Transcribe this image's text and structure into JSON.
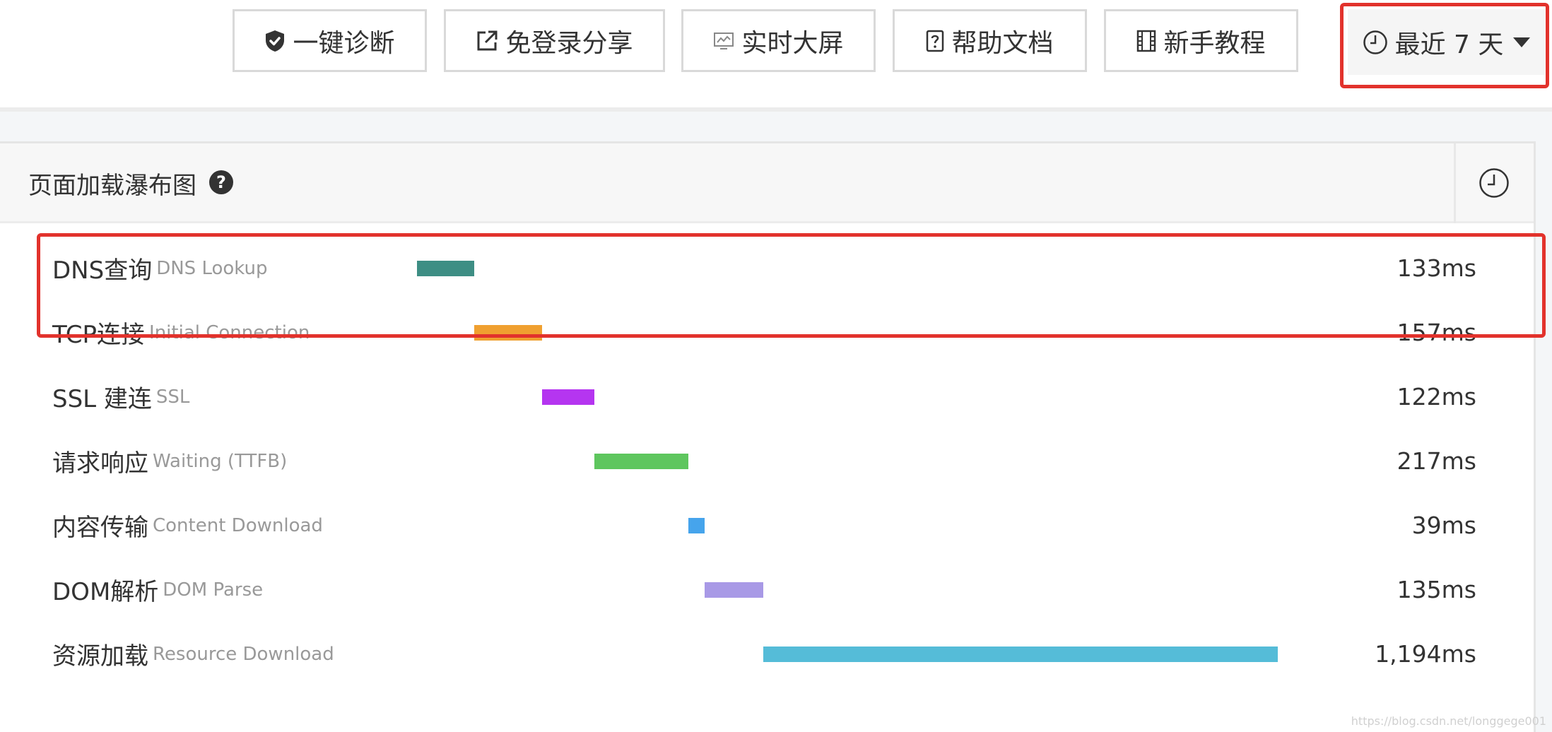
{
  "toolbar": {
    "buttons": [
      {
        "label": "一键诊断",
        "icon": "shield-icon"
      },
      {
        "label": "免登录分享",
        "icon": "share-external-icon"
      },
      {
        "label": "实时大屏",
        "icon": "monitor-icon"
      },
      {
        "label": "帮助文档",
        "icon": "help-doc-icon"
      },
      {
        "label": "新手教程",
        "icon": "film-icon"
      }
    ],
    "time_range": {
      "label": "最近 7 天",
      "icon": "clock-icon"
    }
  },
  "panel": {
    "title": "页面加载瀑布图",
    "help_icon": "?",
    "history_icon": "clock-icon"
  },
  "waterfall": {
    "rows": [
      {
        "label_zh": "DNS查询",
        "label_en": "DNS Lookup",
        "value": "133ms",
        "ms": 133,
        "color": "#3e8e84"
      },
      {
        "label_zh": "TCP连接",
        "label_en": "Initial Connection",
        "value": "157ms",
        "ms": 157,
        "color": "#f0a030"
      },
      {
        "label_zh": "SSL 建连",
        "label_en": "SSL",
        "value": "122ms",
        "ms": 122,
        "color": "#b535f0"
      },
      {
        "label_zh": "请求响应",
        "label_en": "Waiting (TTFB)",
        "value": "217ms",
        "ms": 217,
        "color": "#5ec65e"
      },
      {
        "label_zh": "内容传输",
        "label_en": "Content Download",
        "value": "39ms",
        "ms": 39,
        "color": "#46a4ec"
      },
      {
        "label_zh": "DOM解析",
        "label_en": "DOM Parse",
        "value": "135ms",
        "ms": 135,
        "color": "#a899e6"
      },
      {
        "label_zh": "资源加载",
        "label_en": "Resource Download",
        "value": "1,194ms",
        "ms": 1194,
        "color": "#55bcd8"
      }
    ]
  },
  "watermark": "https://blog.csdn.net/longgege001"
}
